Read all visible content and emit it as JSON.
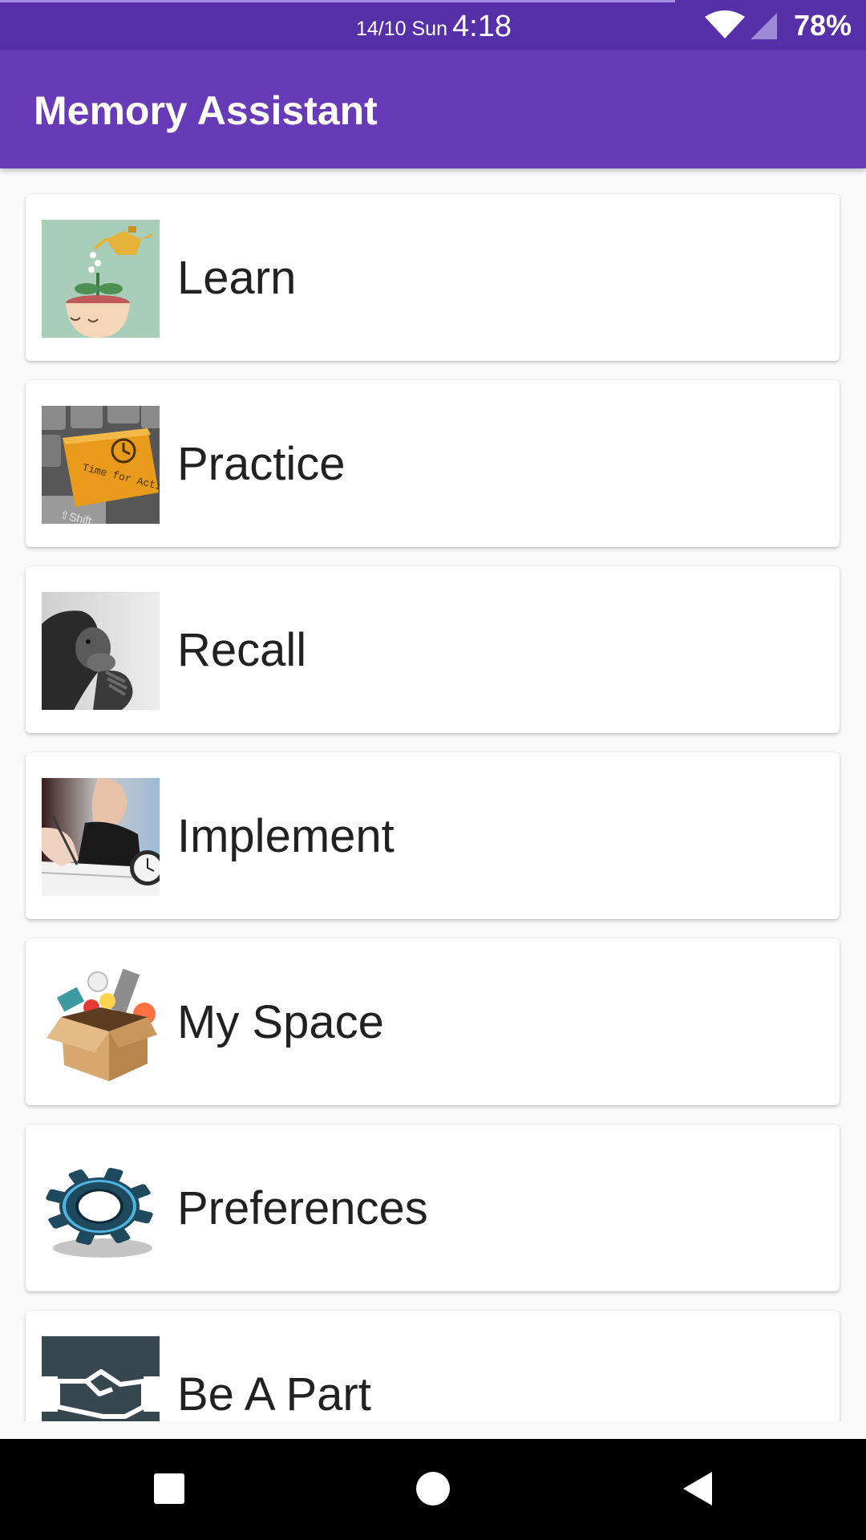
{
  "status_bar": {
    "date": "14/10 Sun",
    "time": "4:18",
    "battery": "78%",
    "icons": [
      "wifi-icon",
      "cell-signal-icon"
    ]
  },
  "app_bar": {
    "title": "Memory Assistant"
  },
  "menu": {
    "items": [
      {
        "label": "Learn",
        "image": "watering-head-plant-image"
      },
      {
        "label": "Practice",
        "image": "time-for-action-key-image"
      },
      {
        "label": "Recall",
        "image": "thinking-chimpanzee-image"
      },
      {
        "label": "Implement",
        "image": "writing-hand-clock-image"
      },
      {
        "label": "My Space",
        "image": "box-of-items-image"
      },
      {
        "label": "Preferences",
        "image": "gear-image"
      },
      {
        "label": "Be A Part",
        "image": "handshake-image"
      }
    ],
    "thumb_text": {
      "practice_key": "Time for Action",
      "practice_shift": "⇧Shift"
    }
  },
  "navigation_bar": {
    "buttons": [
      "recents-square-icon",
      "home-circle-icon",
      "back-triangle-icon"
    ]
  },
  "colors": {
    "status_bar": "#5530a8",
    "app_bar": "#673ab7",
    "background": "#fafafa",
    "card": "#ffffff",
    "text": "#212121"
  }
}
